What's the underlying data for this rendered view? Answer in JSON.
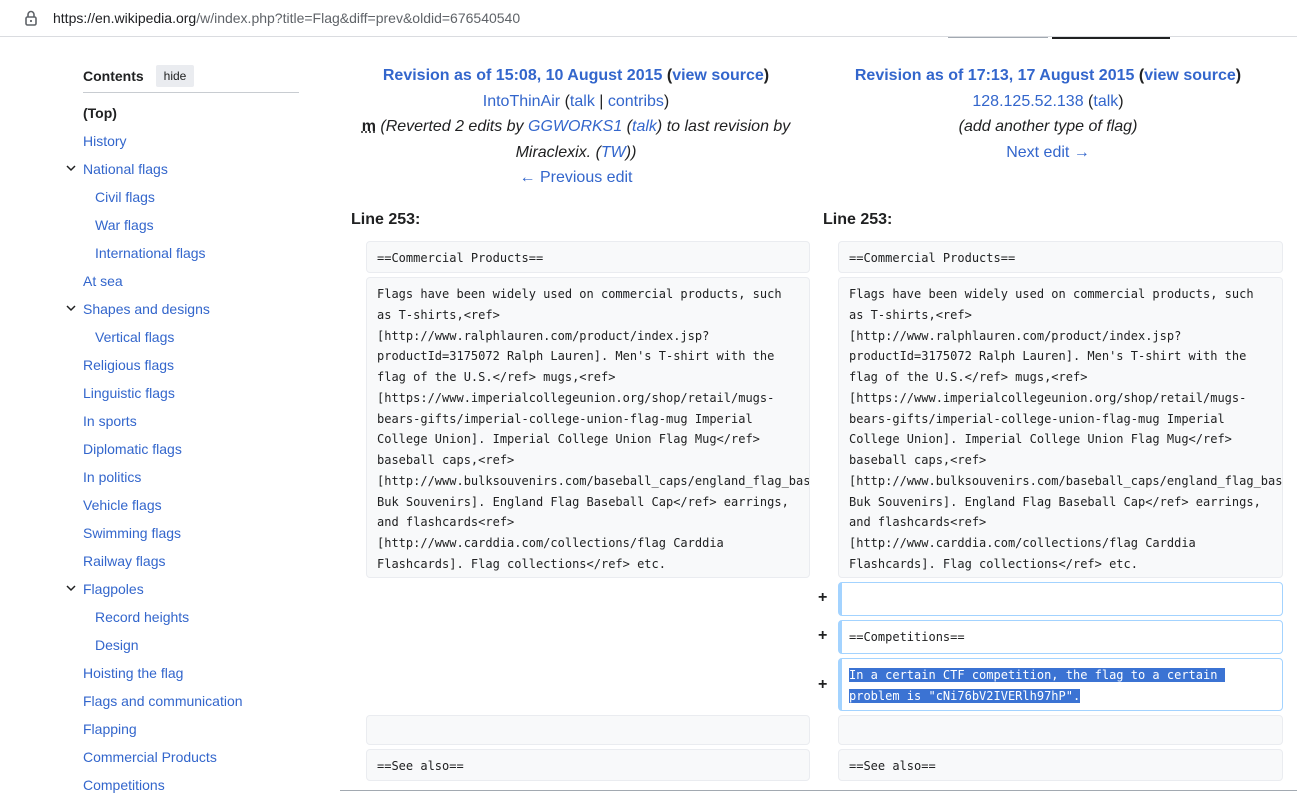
{
  "browser": {
    "url_host": "https://en.wikipedia.org",
    "url_path": "/w/index.php?title=Flag&diff=prev&oldid=676540540"
  },
  "toc": {
    "title": "Contents",
    "hide_label": "hide",
    "items": [
      {
        "label": "(Top)"
      },
      {
        "label": "History"
      },
      {
        "label": "National flags"
      },
      {
        "label": "Civil flags"
      },
      {
        "label": "War flags"
      },
      {
        "label": "International flags"
      },
      {
        "label": "At sea"
      },
      {
        "label": "Shapes and designs"
      },
      {
        "label": "Vertical flags"
      },
      {
        "label": "Religious flags"
      },
      {
        "label": "Linguistic flags"
      },
      {
        "label": "In sports"
      },
      {
        "label": "Diplomatic flags"
      },
      {
        "label": "In politics"
      },
      {
        "label": "Vehicle flags"
      },
      {
        "label": "Swimming flags"
      },
      {
        "label": "Railway flags"
      },
      {
        "label": "Flagpoles"
      },
      {
        "label": "Record heights"
      },
      {
        "label": "Design"
      },
      {
        "label": "Hoisting the flag"
      },
      {
        "label": "Flags and communication"
      },
      {
        "label": "Flapping"
      },
      {
        "label": "Commercial Products"
      },
      {
        "label": "Competitions"
      }
    ]
  },
  "left": {
    "title": "Revision as of 15:08, 10 August 2015",
    "view_source": "view source",
    "user": "IntoThinAir",
    "talk": "talk",
    "contribs": "contribs",
    "minor": "m",
    "summary_pre": "(Reverted 2 edits by ",
    "summary_user": "GGWORKS1",
    "summary_talk": "talk",
    "summary_mid": " to last revision by Miraclexix. (",
    "summary_tw": "TW",
    "summary_end": "))",
    "nav": "← Previous edit",
    "line": "Line 253:"
  },
  "right": {
    "title": "Revision as of 17:13, 17 August 2015",
    "view_source": "view source",
    "user": "128.125.52.138",
    "talk": "talk",
    "summary": "(add another type of flag)",
    "nav": "Next edit →",
    "line": "Line 253:"
  },
  "diff": {
    "heading": "==Commercial Products==",
    "paragraph": "Flags have been widely used on commercial products, such as T-shirts,<ref>[http://www.ralphlauren.com/product/index.jsp?productId=3175072 Ralph Lauren]. Men's T-shirt with the flag of the U.S.</ref> mugs,<ref>[https://www.imperialcollegeunion.org/shop/retail/mugs-bears-gifts/imperial-college-union-flag-mug Imperial College Union]. Imperial College Union Flag Mug</ref> baseball caps,<ref>[http://www.bulksouvenirs.com/baseball_caps/england_flag_baseball_cap.asp Buk Souvenirs]. England Flag Baseball Cap</ref> earrings, and flashcards<ref>[http://www.carddia.com/collections/flag Carddia Flashcards]. Flag collections</ref> etc.",
    "added_marker": "+",
    "added_competitions": "==Competitions==",
    "added_text": "In a certain CTF competition, the flag to a certain problem is \"cNi76bV2IVERlh97hP\".",
    "see_also": "==See also=="
  }
}
